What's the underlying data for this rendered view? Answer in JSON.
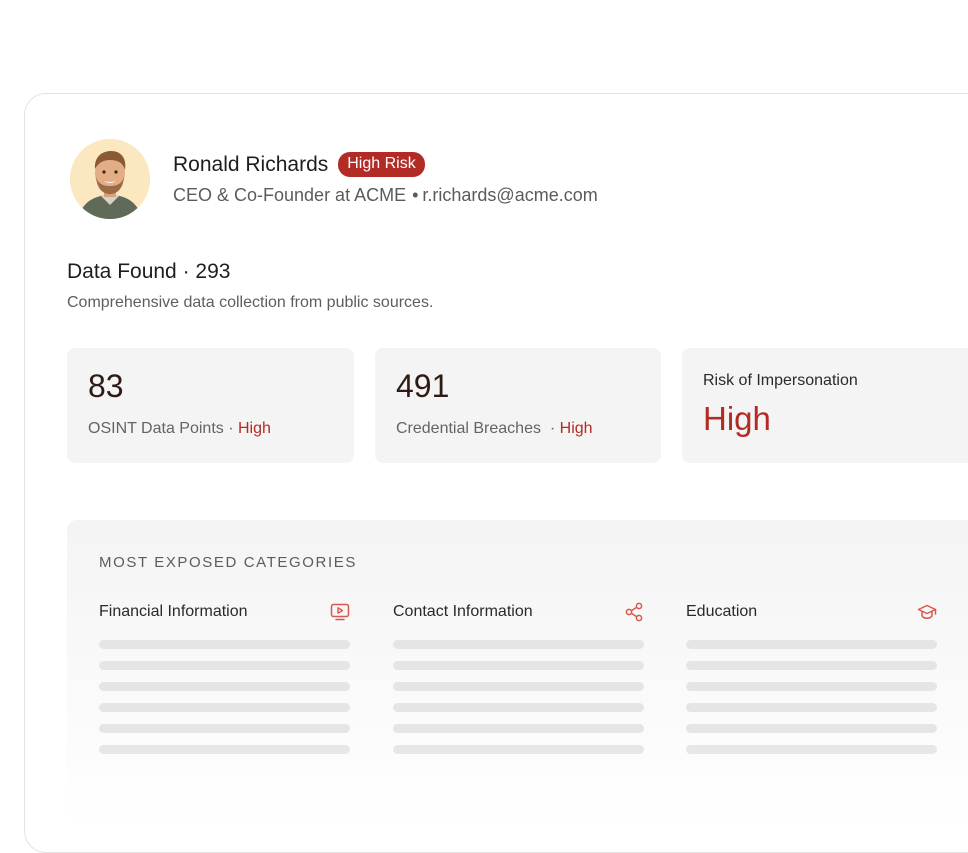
{
  "profile": {
    "name": "Ronald Richards",
    "risk_badge": "High Risk",
    "role": "CEO & Co-Founder at ACME",
    "separator": "•",
    "email": "r.richards@acme.com"
  },
  "data_found": {
    "title": "Data Found · 293",
    "description": "Comprehensive data collection from public sources."
  },
  "stats": [
    {
      "value": "83",
      "label": "OSINT Data Points · ",
      "level": "High"
    },
    {
      "value": "491",
      "label": "Credential Breaches  · ",
      "level": "High"
    },
    {
      "label": "Risk of Impersonation",
      "value": "High"
    }
  ],
  "categories": {
    "heading": "MOST EXPOSED CATEGORIES",
    "items": [
      {
        "title": "Financial Information",
        "icon": "video-icon"
      },
      {
        "title": "Contact Information",
        "icon": "share-icon"
      },
      {
        "title": "Education",
        "icon": "graduation-cap-icon"
      }
    ]
  },
  "colors": {
    "accent": "#b32b25",
    "icon": "#d9574c",
    "avatar_bg": "#fbe7c0"
  }
}
